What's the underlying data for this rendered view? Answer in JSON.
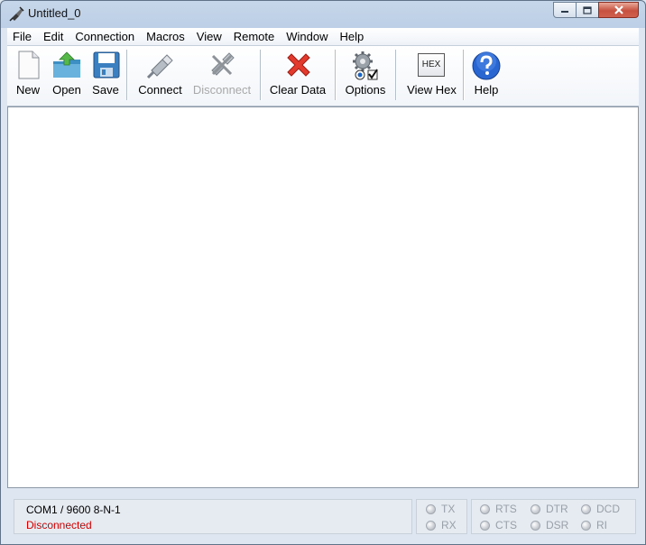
{
  "window": {
    "title": "Untitled_0"
  },
  "menu": [
    "File",
    "Edit",
    "Connection",
    "Macros",
    "View",
    "Remote",
    "Window",
    "Help"
  ],
  "toolbar": {
    "new": "New",
    "open": "Open",
    "save": "Save",
    "connect": "Connect",
    "disconnect": "Disconnect",
    "clear": "Clear Data",
    "options": "Options",
    "hex_badge": "HEX",
    "view_hex": "View Hex",
    "help": "Help"
  },
  "status": {
    "port": "COM1 / 9600 8-N-1",
    "connection": "Disconnected"
  },
  "signals": {
    "tx": "TX",
    "rx": "RX",
    "rts": "RTS",
    "cts": "CTS",
    "dtr": "DTR",
    "dsr": "DSR",
    "dcd": "DCD",
    "ri": "RI"
  },
  "colors": {
    "status_disconnected": "#d10000",
    "disabled_text": "#a8a8a8"
  }
}
